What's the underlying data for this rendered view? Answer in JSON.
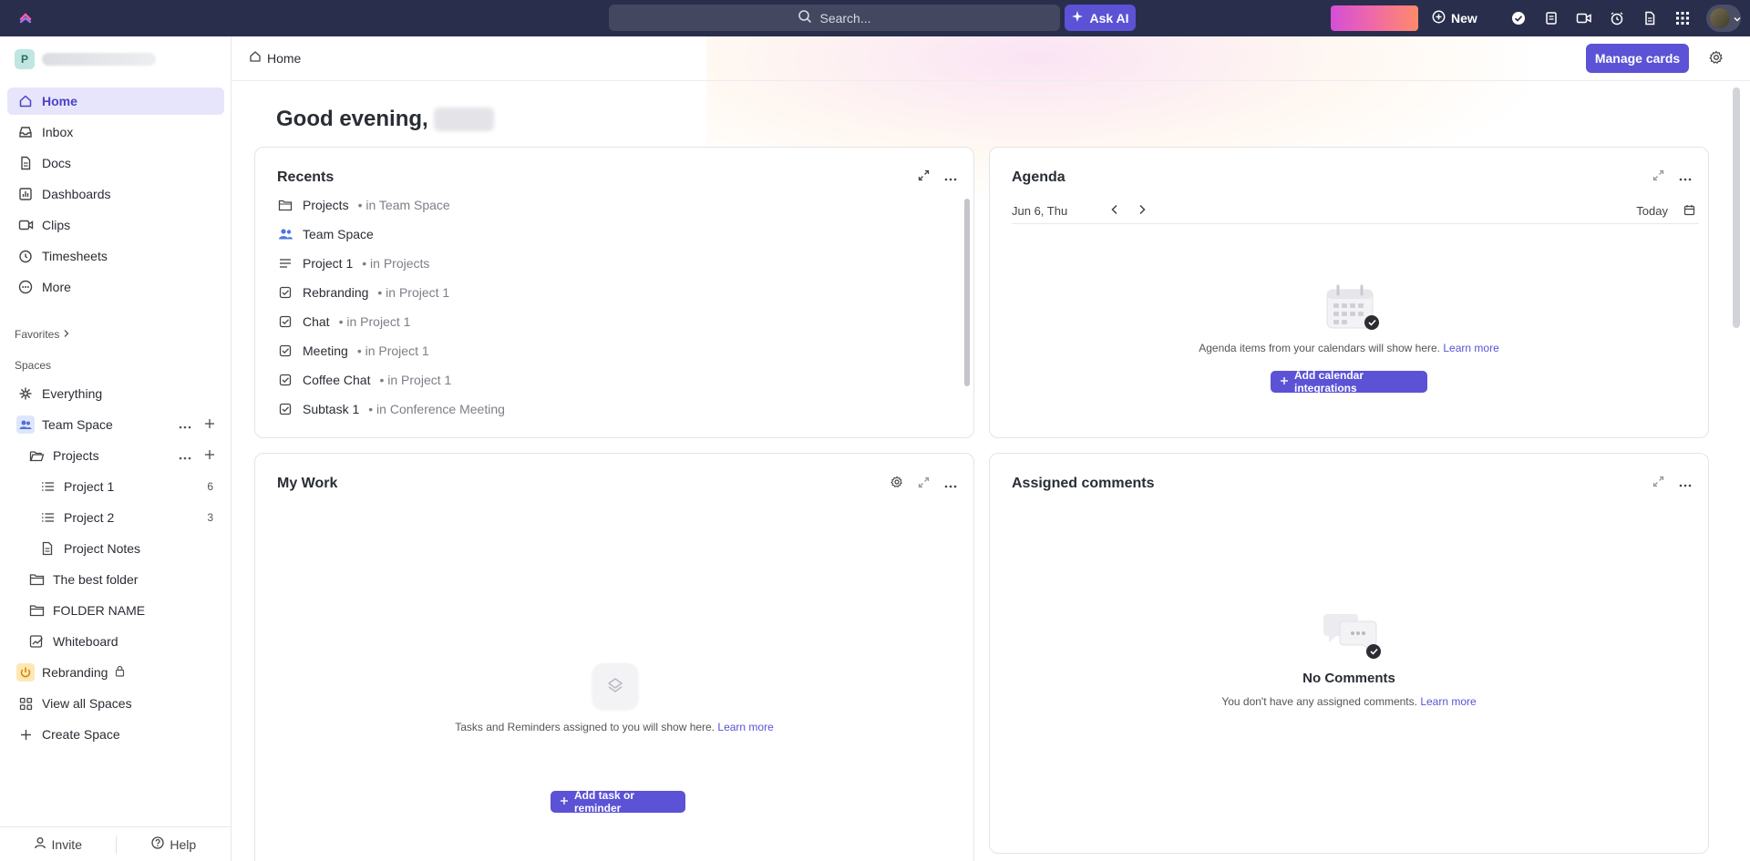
{
  "topbar": {
    "search_placeholder": "Search...",
    "ask_ai_label": "Ask AI",
    "new_label": "New"
  },
  "sidebar": {
    "workspace_initial": "P",
    "nav": [
      {
        "label": "Home"
      },
      {
        "label": "Inbox"
      },
      {
        "label": "Docs"
      },
      {
        "label": "Dashboards"
      },
      {
        "label": "Clips"
      },
      {
        "label": "Timesheets"
      },
      {
        "label": "More"
      }
    ],
    "favorites_label": "Favorites",
    "spaces_label": "Spaces",
    "spaces": [
      {
        "label": "Everything"
      },
      {
        "label": "Team Space"
      },
      {
        "label": "Projects"
      },
      {
        "label": "Project 1",
        "count": "6"
      },
      {
        "label": "Project 2",
        "count": "3"
      },
      {
        "label": "Project Notes"
      },
      {
        "label": "The best folder"
      },
      {
        "label": "FOLDER NAME"
      },
      {
        "label": "Whiteboard"
      },
      {
        "label": "Rebranding"
      },
      {
        "label": "View all Spaces"
      },
      {
        "label": "Create Space"
      }
    ],
    "invite_label": "Invite",
    "help_label": "Help"
  },
  "header": {
    "breadcrumb": "Home",
    "manage_cards_label": "Manage cards"
  },
  "greeting": "Good evening,",
  "recents": {
    "title": "Recents",
    "items": [
      {
        "name": "Projects",
        "loc": "• in Team Space",
        "icon": "folder-icon"
      },
      {
        "name": "Team Space",
        "loc": "",
        "icon": "people-icon"
      },
      {
        "name": "Project 1",
        "loc": "• in Projects",
        "icon": "list-icon"
      },
      {
        "name": "Rebranding",
        "loc": "• in Project 1",
        "icon": "task-check-icon"
      },
      {
        "name": "Chat",
        "loc": "• in Project 1",
        "icon": "task-check-icon"
      },
      {
        "name": "Meeting",
        "loc": "• in Project 1",
        "icon": "task-check-icon"
      },
      {
        "name": "Coffee Chat",
        "loc": "• in Project 1",
        "icon": "task-check-icon"
      },
      {
        "name": "Subtask 1",
        "loc": "• in Conference Meeting",
        "icon": "task-check-icon"
      }
    ]
  },
  "agenda": {
    "title": "Agenda",
    "date": "Jun 6, Thu",
    "today_label": "Today",
    "empty_text": "Agenda items from your calendars will show here.",
    "learn_more": "Learn more",
    "button_label": "Add calendar integrations"
  },
  "mywork": {
    "title": "My Work",
    "empty_text": "Tasks and Reminders assigned to you will show here.",
    "learn_more": "Learn more",
    "button_label": "Add task or reminder"
  },
  "comments": {
    "title": "Assigned comments",
    "empty_title": "No Comments",
    "empty_text": "You don't have any assigned comments.",
    "learn_more": "Learn more"
  },
  "colors": {
    "topbar": "#2a2e4d",
    "accent": "#5b52d6",
    "active_nav": "#e7e5fb"
  }
}
